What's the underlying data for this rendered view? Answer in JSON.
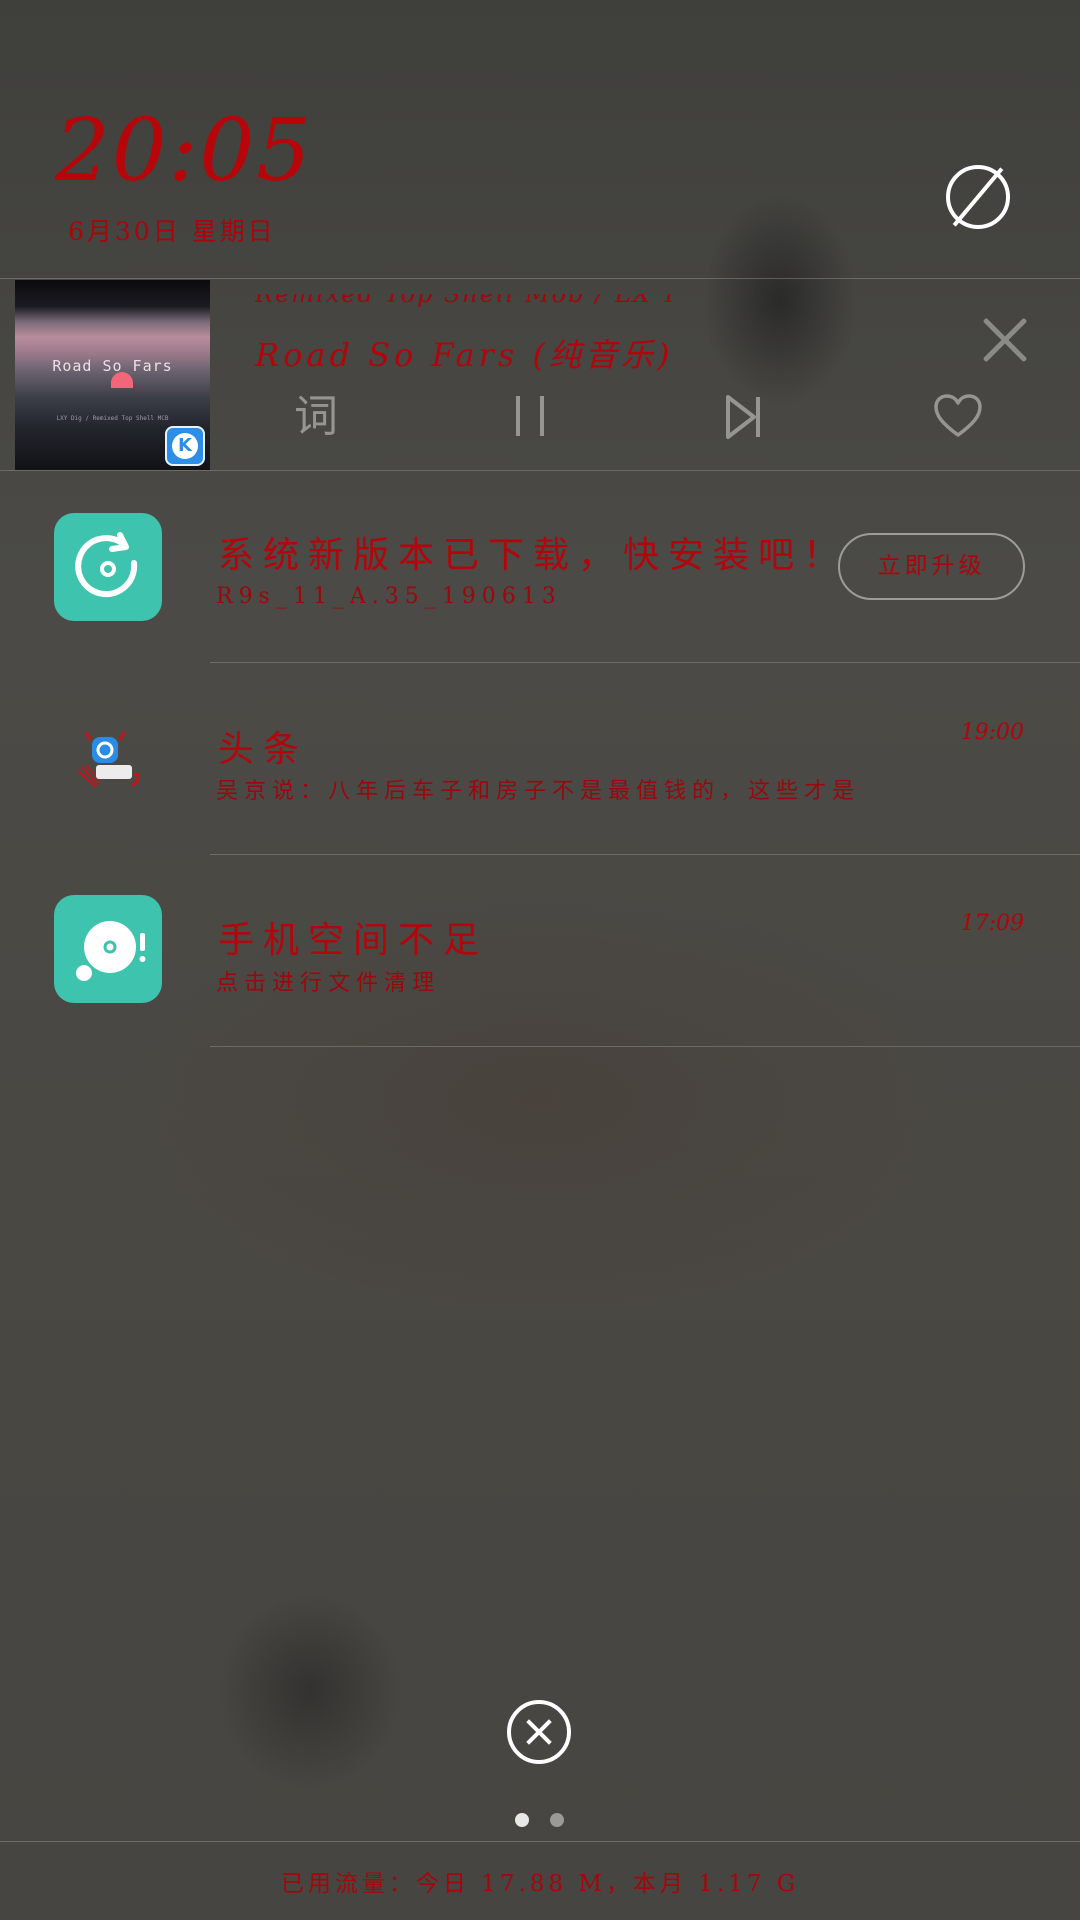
{
  "header": {
    "time": "20:05",
    "date": "6月30日 星期日",
    "dnd_icon": "do-not-disturb-icon"
  },
  "music": {
    "album_title": "Road So Fars",
    "album_subtitle": "LXY Dig / Remixed Top Shell MCB",
    "artist": "Remixed Top Shell Mob / LX Y",
    "title": "Road So Fars (纯音乐)",
    "controls": {
      "lyrics": "词",
      "pause_icon": "pause-icon",
      "next_icon": "skip-next-icon",
      "favorite_icon": "heart-icon",
      "close_icon": "close-icon"
    },
    "badge_letter": "K"
  },
  "notifications": [
    {
      "icon": "system-update-icon",
      "title": "系统新版本已下载，快安装吧！",
      "body": "R9s_11_A.35_190613",
      "action": "立即升级"
    },
    {
      "icon": "toutiao-app-icon",
      "title": "头条",
      "body": "吴京说：八年后车子和房子不是最值钱的，这些才是",
      "time": "19:00"
    },
    {
      "icon": "storage-warning-icon",
      "title": "手机空间不足",
      "body": "点击进行文件清理",
      "time": "17:09"
    }
  ],
  "footer": {
    "clear_icon": "clear-all-icon",
    "page_count": 2,
    "active_page": 1,
    "usage": "已用流量：今日 17.88 M，本月 1.17 G"
  }
}
